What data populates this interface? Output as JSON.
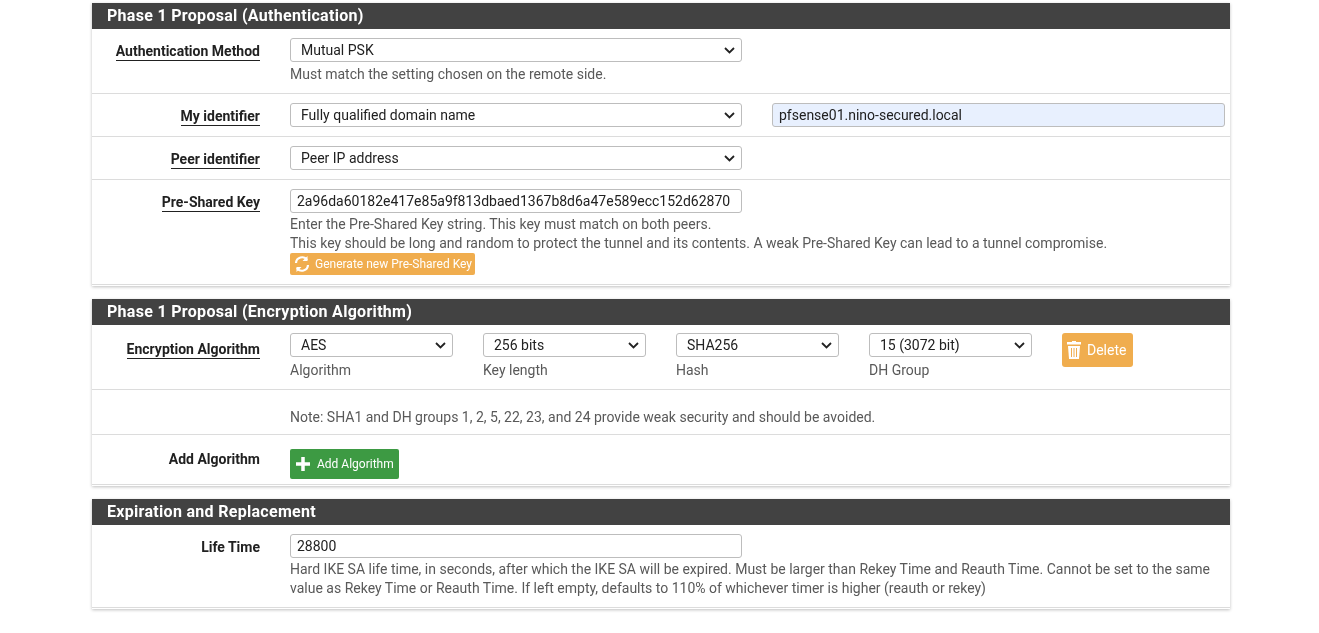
{
  "sections": [
    {
      "title": "Phase 1 Proposal (Authentication)",
      "rows": [
        {
          "kind": "select",
          "label": "Authentication Method",
          "link": true,
          "value": "Mutual PSK",
          "help": [
            "Must match the setting chosen on the remote side."
          ]
        },
        {
          "kind": "select",
          "label": "My identifier",
          "link": true,
          "value": "Fully qualified domain name",
          "extra_value": "pfsense01.nino-secured.local"
        },
        {
          "kind": "select",
          "label": "Peer identifier",
          "link": true,
          "value": "Peer IP address"
        },
        {
          "kind": "input",
          "label": "Pre-Shared Key",
          "link": true,
          "value": "2a96da60182e417e85a9f813dbaed1367b8d6a47e589ecc152d62870",
          "help": [
            "Enter the Pre-Shared Key string. This key must match on both peers.",
            "This key should be long and random to protect the tunnel and its contents. A weak Pre-Shared Key can lead to a tunnel compromise."
          ],
          "button": "Generate new Pre-Shared Key"
        }
      ]
    },
    {
      "title": "Phase 1 Proposal (Encryption Algorithm)",
      "rows": [
        {
          "kind": "algorithms",
          "label": "Encryption Algorithm",
          "link": true,
          "fields": [
            {
              "value": "AES",
              "caption": "Algorithm"
            },
            {
              "value": "256 bits",
              "caption": "Key length"
            },
            {
              "value": "SHA256",
              "caption": "Hash"
            },
            {
              "value": "15 (3072 bit)",
              "caption": "DH Group"
            }
          ],
          "button": "Delete"
        },
        {
          "kind": "note",
          "text": "Note: SHA1 and DH groups 1, 2, 5, 22, 23, and 24 provide weak security and should be avoided."
        },
        {
          "kind": "add",
          "label": "Add Algorithm",
          "link": false,
          "button": "Add Algorithm"
        }
      ]
    },
    {
      "title": "Expiration and Replacement",
      "rows": [
        {
          "kind": "input",
          "label": "Life Time",
          "link": false,
          "value": "28800",
          "help": [
            "Hard IKE SA life time, in seconds, after which the IKE SA will be expired. Must be larger than Rekey Time and Reauth Time. Cannot be set to the same value as Rekey Time or Reauth Time. If left empty, defaults to 110% of whichever timer is higher (reauth or rekey)"
          ]
        }
      ]
    }
  ]
}
